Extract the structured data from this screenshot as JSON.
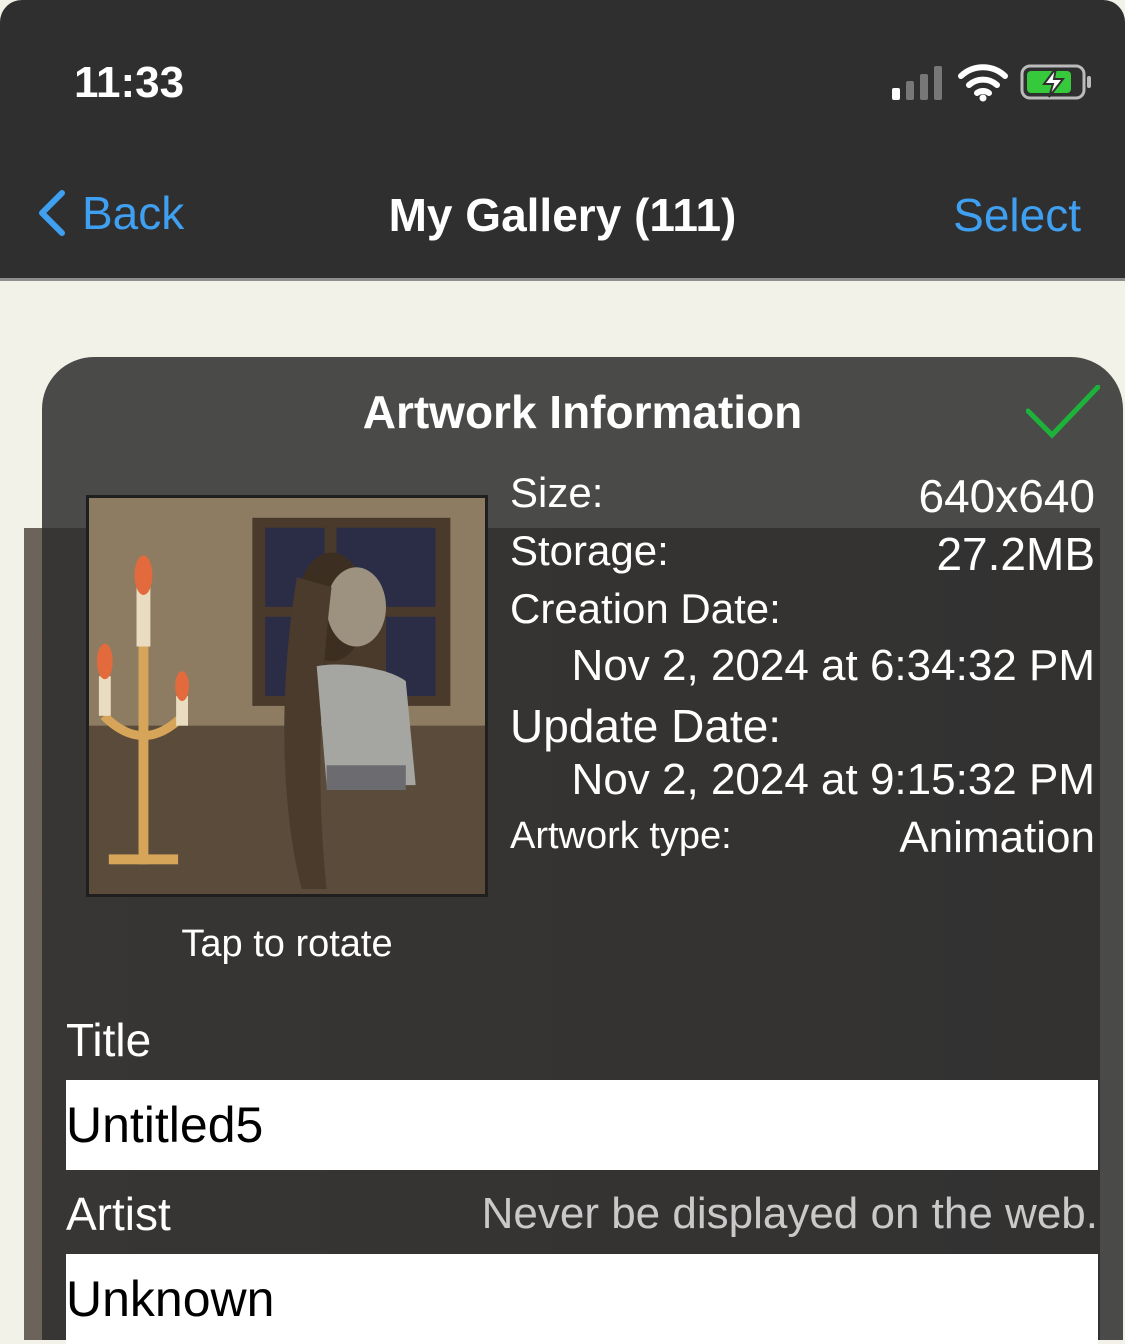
{
  "status_bar": {
    "time": "11:33",
    "icons": [
      "cellular-signal-icon",
      "wifi-icon",
      "battery-charging-icon"
    ]
  },
  "nav": {
    "back_label": "Back",
    "title": "My Gallery (111)",
    "select_label": "Select"
  },
  "panel": {
    "title": "Artwork Information",
    "confirm_icon": "checkmark-icon",
    "thumbnail_hint": "Tap to rotate",
    "info": {
      "size_label": "Size:",
      "size_value": "640x640",
      "storage_label": "Storage:",
      "storage_value": "27.2MB",
      "creation_label": "Creation Date:",
      "creation_value": "Nov 2, 2024 at 6:34:32 PM",
      "update_label": "Update Date:",
      "update_value": "Nov 2, 2024 at 9:15:32 PM",
      "type_label": "Artwork type:",
      "type_value": "Animation"
    },
    "title_field": {
      "label": "Title",
      "value": "Untitled5"
    },
    "artist_field": {
      "label": "Artist",
      "hint": "Never be displayed on the web.",
      "value": "Unknown"
    }
  },
  "colors": {
    "accent": "#3f9ff0",
    "bar_background": "#2f2f2f",
    "page_background": "#f2f2e9",
    "confirm": "#1db33a"
  }
}
